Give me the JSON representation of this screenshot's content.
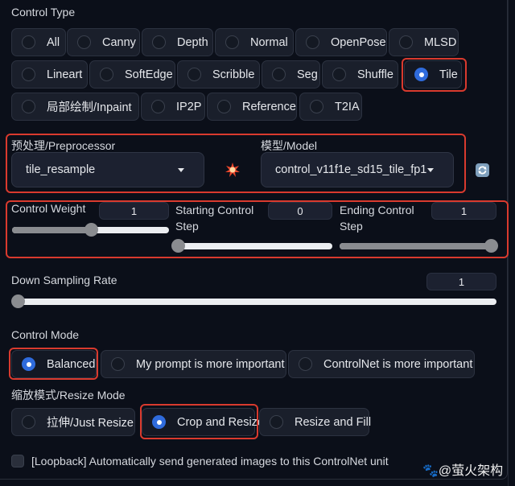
{
  "control_type": {
    "label": "Control Type",
    "selected": "Tile",
    "options": [
      "All",
      "Canny",
      "Depth",
      "Normal",
      "OpenPose",
      "MLSD",
      "Lineart",
      "SoftEdge",
      "Scribble",
      "Seg",
      "Shuffle",
      "Tile",
      "局部绘制/Inpaint",
      "IP2P",
      "Reference",
      "T2IA"
    ]
  },
  "preprocessor": {
    "label": "预处理/Preprocessor",
    "value": "tile_resample",
    "run_icon": "explosion-icon"
  },
  "model": {
    "label": "模型/Model",
    "value": "control_v11f1e_sd15_tile_fp1",
    "refresh_icon": "refresh-icon"
  },
  "control_weight": {
    "label": "Control Weight",
    "value": "1",
    "fraction": 0.5
  },
  "starting_step": {
    "label": "Starting Control Step",
    "value": "0",
    "fraction": 0.0
  },
  "ending_step": {
    "label": "Ending Control Step",
    "value": "1",
    "fraction": 1.0
  },
  "down_sampling": {
    "label": "Down Sampling Rate",
    "value": "1",
    "fraction": 0.0
  },
  "control_mode": {
    "label": "Control Mode",
    "selected": "Balanced",
    "options": [
      "Balanced",
      "My prompt is more important",
      "ControlNet is more important"
    ]
  },
  "resize_mode": {
    "label": "缩放模式/Resize Mode",
    "selected": "Crop and Resize",
    "options": [
      "拉伸/Just Resize",
      "Crop and Resize",
      "Resize and Fill"
    ]
  },
  "loopback": {
    "label": "[Loopback] Automatically send generated images to this ControlNet unit",
    "checked": false
  },
  "watermark": "@萤火架构",
  "colors": {
    "accent": "#2f6bdc",
    "highlight": "#d93a2e",
    "background": "#0b0f19"
  }
}
